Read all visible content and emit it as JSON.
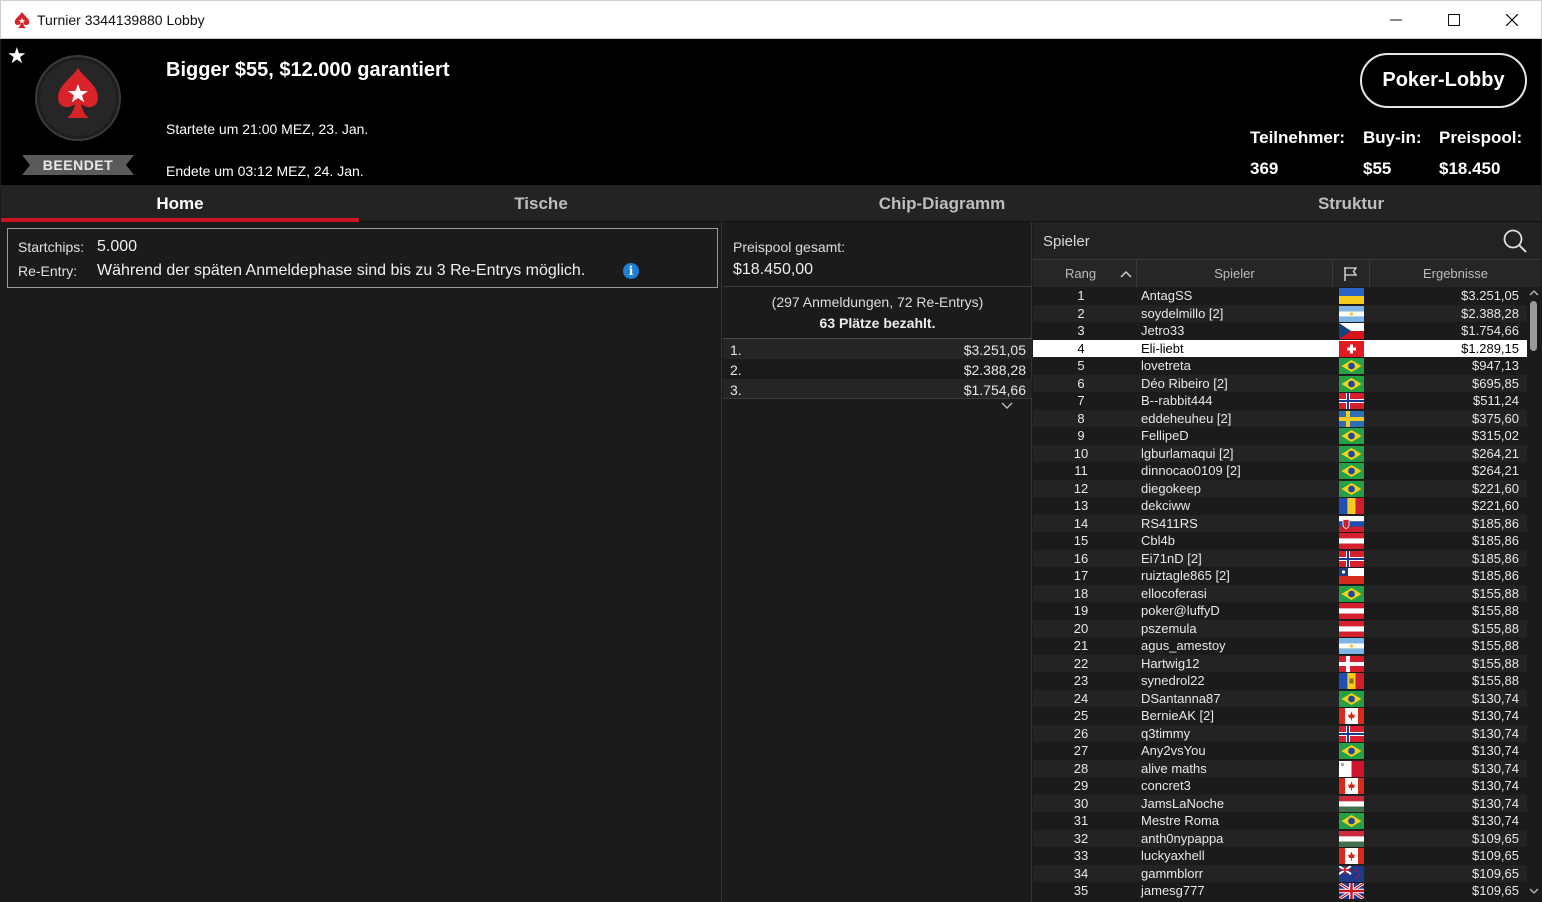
{
  "window": {
    "title": "Turnier 3344139880 Lobby",
    "minimize": "—",
    "maximize": "☐",
    "close": "✕"
  },
  "header": {
    "status": "BEENDET",
    "tournament_name": "Bigger $55, $12.000 garantiert",
    "started": "Startete um 21:00 MEZ, 23. Jan.",
    "ended": "Endete um 03:12 MEZ, 24. Jan.",
    "lobby_button": "Poker-Lobby",
    "participants_label": "Teilnehmer:",
    "participants_value": "369",
    "buyin_label": "Buy-in:",
    "buyin_value": "$55",
    "prizepool_label": "Preispool:",
    "prizepool_value": "$18.450",
    "brand_red": "#cc1322"
  },
  "tabs": [
    {
      "label": "Home",
      "active": true
    },
    {
      "label": "Tische",
      "active": false
    },
    {
      "label": "Chip-Diagramm",
      "active": false
    },
    {
      "label": "Struktur",
      "active": false
    }
  ],
  "info": {
    "startchips_label": "Startchips:",
    "startchips_value": "5.000",
    "reentry_label": "Re-Entry:",
    "reentry_value": "Während der späten Anmeldephase sind bis zu 3 Re-Entrys möglich."
  },
  "prizes": {
    "total_label": "Preispool gesamt:",
    "total_value": "$18.450,00",
    "entries_note": "(297 Anmeldungen, 72 Re-Entrys)",
    "paid_note": "63 Plätze bezahlt.",
    "rows": [
      {
        "place": "1.",
        "amount": "$3.251,05"
      },
      {
        "place": "2.",
        "amount": "$2.388,28"
      },
      {
        "place": "3.",
        "amount": "$1.754,66"
      }
    ]
  },
  "players": {
    "search_placeholder": "Spieler",
    "columns": {
      "rank": "Rang",
      "player": "Spieler",
      "result": "Ergebnisse"
    },
    "rows": [
      {
        "rank": "1",
        "name": "AntagSS",
        "flag": "ukraine",
        "result": "$3.251,05"
      },
      {
        "rank": "2",
        "name": "soydelmillo [2]",
        "flag": "argentina",
        "result": "$2.388,28"
      },
      {
        "rank": "3",
        "name": "Jetro33",
        "flag": "czech",
        "result": "$1.754,66"
      },
      {
        "rank": "4",
        "name": "Eli-liebt",
        "flag": "switzerland",
        "result": "$1.289,15",
        "highlight": true
      },
      {
        "rank": "5",
        "name": "lovetreta",
        "flag": "brazil",
        "result": "$947,13"
      },
      {
        "rank": "6",
        "name": "Déo Ribeiro [2]",
        "flag": "brazil",
        "result": "$695,85"
      },
      {
        "rank": "7",
        "name": "B--rabbit444",
        "flag": "norway",
        "result": "$511,24"
      },
      {
        "rank": "8",
        "name": "eddeheuheu [2]",
        "flag": "sweden",
        "result": "$375,60"
      },
      {
        "rank": "9",
        "name": "FellipeD",
        "flag": "brazil",
        "result": "$315,02"
      },
      {
        "rank": "10",
        "name": "lgburlamaqui [2]",
        "flag": "brazil",
        "result": "$264,21"
      },
      {
        "rank": "11",
        "name": "dinnocao0109 [2]",
        "flag": "brazil",
        "result": "$264,21"
      },
      {
        "rank": "12",
        "name": "diegokeep",
        "flag": "brazil",
        "result": "$221,60"
      },
      {
        "rank": "13",
        "name": "dekciww",
        "flag": "romania",
        "result": "$221,60"
      },
      {
        "rank": "14",
        "name": "RS411RS",
        "flag": "slovakia",
        "result": "$185,86"
      },
      {
        "rank": "15",
        "name": "Cbl4b",
        "flag": "austria",
        "result": "$185,86"
      },
      {
        "rank": "16",
        "name": "Ei71nD [2]",
        "flag": "norway",
        "result": "$185,86"
      },
      {
        "rank": "17",
        "name": "ruiztagle865 [2]",
        "flag": "chile",
        "result": "$185,86"
      },
      {
        "rank": "18",
        "name": "ellocoferasi",
        "flag": "brazil",
        "result": "$155,88"
      },
      {
        "rank": "19",
        "name": "poker@luffyD",
        "flag": "austria",
        "result": "$155,88"
      },
      {
        "rank": "20",
        "name": "pszemula",
        "flag": "austria",
        "result": "$155,88"
      },
      {
        "rank": "21",
        "name": "agus_amestoy",
        "flag": "argentina",
        "result": "$155,88"
      },
      {
        "rank": "22",
        "name": "Hartwig12",
        "flag": "denmark",
        "result": "$155,88"
      },
      {
        "rank": "23",
        "name": "synedrol22",
        "flag": "moldova",
        "result": "$155,88"
      },
      {
        "rank": "24",
        "name": "DSantanna87",
        "flag": "brazil",
        "result": "$130,74"
      },
      {
        "rank": "25",
        "name": "BernieAK [2]",
        "flag": "canada",
        "result": "$130,74"
      },
      {
        "rank": "26",
        "name": "q3timmy",
        "flag": "norway",
        "result": "$130,74"
      },
      {
        "rank": "27",
        "name": "Any2vsYou",
        "flag": "brazil",
        "result": "$130,74"
      },
      {
        "rank": "28",
        "name": "alive maths",
        "flag": "malta",
        "result": "$130,74"
      },
      {
        "rank": "29",
        "name": "concret3",
        "flag": "canada",
        "result": "$130,74"
      },
      {
        "rank": "30",
        "name": "JamsLaNoche",
        "flag": "hungary",
        "result": "$130,74"
      },
      {
        "rank": "31",
        "name": "Mestre Roma",
        "flag": "brazil",
        "result": "$130,74"
      },
      {
        "rank": "32",
        "name": "anth0nypappa",
        "flag": "hungary",
        "result": "$109,65"
      },
      {
        "rank": "33",
        "name": "luckyaxhell",
        "flag": "canada",
        "result": "$109,65"
      },
      {
        "rank": "34",
        "name": "gammblorr",
        "flag": "newzealand",
        "result": "$109,65"
      },
      {
        "rank": "35",
        "name": "jamesg777",
        "flag": "uk",
        "result": "$109,65"
      }
    ]
  }
}
